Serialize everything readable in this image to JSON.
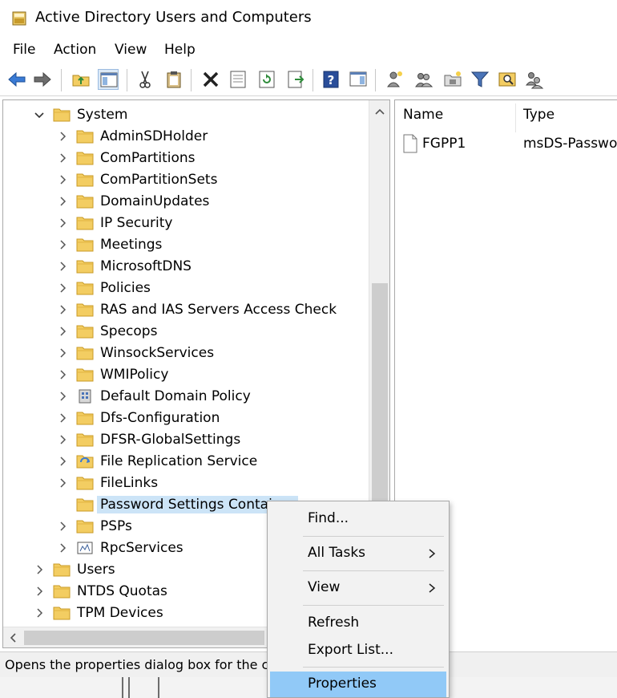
{
  "window": {
    "title": "Active Directory Users and Computers"
  },
  "menubar": {
    "items": [
      {
        "label": "File"
      },
      {
        "label": "Action"
      },
      {
        "label": "View"
      },
      {
        "label": "Help"
      }
    ]
  },
  "toolbar": {
    "icons": [
      "back-arrow-icon",
      "forward-arrow-icon",
      "up-folder-icon",
      "show-console-tree-icon",
      "cut-icon",
      "copy-icon",
      "delete-icon",
      "properties-icon",
      "refresh-icon",
      "export-list-icon",
      "help-icon",
      "action-pane-icon",
      "new-user-icon",
      "new-group-icon",
      "new-ou-icon",
      "filter-icon",
      "find-icon",
      "add-to-group-icon"
    ]
  },
  "tree": {
    "items": [
      {
        "label": "System",
        "depth": 1,
        "expanded": true,
        "icon": "folder-icon"
      },
      {
        "label": "AdminSDHolder",
        "depth": 2,
        "icon": "folder-icon"
      },
      {
        "label": "ComPartitions",
        "depth": 2,
        "icon": "folder-icon"
      },
      {
        "label": "ComPartitionSets",
        "depth": 2,
        "icon": "folder-icon"
      },
      {
        "label": "DomainUpdates",
        "depth": 2,
        "icon": "folder-icon"
      },
      {
        "label": "IP Security",
        "depth": 2,
        "icon": "folder-icon"
      },
      {
        "label": "Meetings",
        "depth": 2,
        "icon": "folder-icon"
      },
      {
        "label": "MicrosoftDNS",
        "depth": 2,
        "icon": "folder-icon"
      },
      {
        "label": "Policies",
        "depth": 2,
        "icon": "folder-icon"
      },
      {
        "label": "RAS and IAS Servers Access Check",
        "depth": 2,
        "icon": "folder-icon"
      },
      {
        "label": "Specops",
        "depth": 2,
        "icon": "folder-icon"
      },
      {
        "label": "WinsockServices",
        "depth": 2,
        "icon": "folder-icon"
      },
      {
        "label": "WMIPolicy",
        "depth": 2,
        "icon": "folder-icon"
      },
      {
        "label": "Default Domain Policy",
        "depth": 2,
        "icon": "domain-policy-icon"
      },
      {
        "label": "Dfs-Configuration",
        "depth": 2,
        "icon": "folder-icon"
      },
      {
        "label": "DFSR-GlobalSettings",
        "depth": 2,
        "icon": "folder-icon"
      },
      {
        "label": "File Replication Service",
        "depth": 2,
        "icon": "replication-icon"
      },
      {
        "label": "FileLinks",
        "depth": 2,
        "icon": "folder-icon"
      },
      {
        "label": "Password Settings Container",
        "depth": 2,
        "icon": "folder-icon",
        "no_chevron": true,
        "selected": true
      },
      {
        "label": "PSPs",
        "depth": 2,
        "icon": "folder-icon"
      },
      {
        "label": "RpcServices",
        "depth": 2,
        "icon": "rpc-services-icon"
      },
      {
        "label": "Users",
        "depth": 1,
        "icon": "folder-icon"
      },
      {
        "label": "NTDS Quotas",
        "depth": 1,
        "icon": "folder-icon"
      },
      {
        "label": "TPM Devices",
        "depth": 1,
        "icon": "folder-icon"
      }
    ]
  },
  "list": {
    "columns": [
      "Name",
      "Type"
    ],
    "rows": [
      {
        "name": "FGPP1",
        "type": "msDS-Passwor"
      }
    ]
  },
  "context_menu": {
    "items": [
      {
        "label": "Find...",
        "submenu": false
      },
      {
        "label": "All Tasks",
        "submenu": true
      },
      {
        "label": "View",
        "submenu": true
      },
      {
        "label": "Refresh",
        "submenu": false
      },
      {
        "label": "Export List...",
        "submenu": false
      },
      {
        "label": "Properties",
        "submenu": false,
        "highlighted": true
      }
    ]
  },
  "statusbar": {
    "text": "Opens the properties dialog box for the cu"
  },
  "colors": {
    "selection": "#cce4f7",
    "menu_highlight": "#91c9f7",
    "folder": "#f3cd62",
    "folder_edge": "#c89a24",
    "arrow_blue": "#3a7bd5"
  }
}
